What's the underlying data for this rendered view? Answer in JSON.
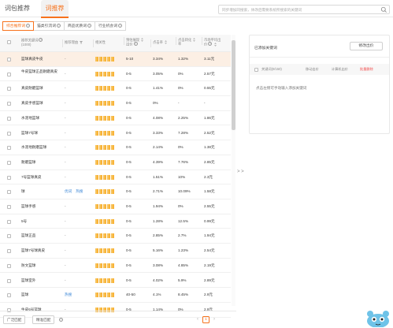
{
  "top_tabs": [
    {
      "label": "词包推荐",
      "active": false
    },
    {
      "label": "词推荐",
      "active": true
    }
  ],
  "search": {
    "placeholder": "同步增加同搜索，体改后需要系统所搜索的关键词"
  },
  "sub_tabs": [
    {
      "label": "综合推荐词",
      "active": true
    },
    {
      "label": "猫类引流词",
      "active": false
    },
    {
      "label": "商品优质词",
      "active": false
    },
    {
      "label": "行业机会词",
      "active": false
    }
  ],
  "table": {
    "headers": {
      "keyword": "推荐关键词",
      "keyword_sub": "(1000)",
      "reason": "推荐理由",
      "relevance": "相关性",
      "price": "预估展现",
      "price_sub": "出价",
      "ctr": "点击率",
      "cvr": "点击转化",
      "cvr_sub": "率",
      "avg": "市场平均出",
      "avg_sub": "价"
    },
    "rows": [
      {
        "keyword": "篮球真皮牛皮",
        "reason": "-",
        "reason_links": [],
        "relevance": 10,
        "price": "5-10",
        "ctr": "3.34%",
        "cvr": "1.32%",
        "avg": "3.11元"
      },
      {
        "keyword": "牛皮篮球正品耐磨真皮",
        "reason": "-",
        "reason_links": [],
        "relevance": 10,
        "price": "0-5",
        "ctr": "3.05%",
        "cvr": "0%",
        "avg": "2.57元"
      },
      {
        "keyword": "真皮耐磨篮球",
        "reason": "-",
        "reason_links": [],
        "relevance": 10,
        "price": "0-5",
        "ctr": "1.41%",
        "cvr": "0%",
        "avg": "0.55元"
      },
      {
        "keyword": "真皮手感篮球",
        "reason": "-",
        "reason_links": [],
        "relevance": 10,
        "price": "0-5",
        "ctr": "0%",
        "cvr": "-",
        "avg": "-"
      },
      {
        "keyword": "水泥地篮球",
        "reason": "-",
        "reason_links": [],
        "relevance": 10,
        "price": "0-5",
        "ctr": "4.08%",
        "cvr": "2.25%",
        "avg": "1.86元"
      },
      {
        "keyword": "篮球7号球",
        "reason": "-",
        "reason_links": [],
        "relevance": 10,
        "price": "0-5",
        "ctr": "3.33%",
        "cvr": "7.28%",
        "avg": "2.52元"
      },
      {
        "keyword": "水泥地耐磨篮球",
        "reason": "-",
        "reason_links": [],
        "relevance": 10,
        "price": "0-5",
        "ctr": "2.14%",
        "cvr": "0%",
        "avg": "1.38元"
      },
      {
        "keyword": "耐磨篮球",
        "reason": "-",
        "reason_links": [],
        "relevance": 10,
        "price": "0-5",
        "ctr": "4.39%",
        "cvr": "7.76%",
        "avg": "2.85元"
      },
      {
        "keyword": "7号篮球真皮",
        "reason": "-",
        "reason_links": [],
        "relevance": 10,
        "price": "0-5",
        "ctr": "1.51%",
        "cvr": "10%",
        "avg": "2.3元"
      },
      {
        "keyword": "球",
        "reason": "",
        "reason_links": [
          "优词",
          "热搜"
        ],
        "relevance": 10,
        "price": "0-5",
        "ctr": "2.71%",
        "cvr": "10.09%",
        "avg": "1.58元"
      },
      {
        "keyword": "篮球手感",
        "reason": "-",
        "reason_links": [],
        "relevance": 10,
        "price": "0-5",
        "ctr": "1.94%",
        "cvr": "0%",
        "avg": "2.55元"
      },
      {
        "keyword": "5号",
        "reason": "-",
        "reason_links": [],
        "relevance": 10,
        "price": "0-5",
        "ctr": "1.28%",
        "cvr": "12.5%",
        "avg": "0.99元"
      },
      {
        "keyword": "篮球正品",
        "reason": "-",
        "reason_links": [],
        "relevance": 10,
        "price": "0-5",
        "ctr": "2.85%",
        "cvr": "2.7%",
        "avg": "1.94元"
      },
      {
        "keyword": "篮球7号球真皮",
        "reason": "-",
        "reason_links": [],
        "relevance": 10,
        "price": "0-5",
        "ctr": "5.16%",
        "cvr": "1.23%",
        "avg": "2.54元"
      },
      {
        "keyword": "防文篮球",
        "reason": "-",
        "reason_links": [],
        "relevance": 10,
        "price": "0-5",
        "ctr": "3.08%",
        "cvr": "4.85%",
        "avg": "2.19元"
      },
      {
        "keyword": "篮球室外",
        "reason": "-",
        "reason_links": [],
        "relevance": 10,
        "price": "0-5",
        "ctr": "4.02%",
        "cvr": "5.9%",
        "avg": "2.89元"
      },
      {
        "keyword": "篮球",
        "reason": "",
        "reason_links": [
          "热搜"
        ],
        "relevance": 10,
        "price": "40-50",
        "ctr": "4.1%",
        "cvr": "8.45%",
        "avg": "2.9元"
      },
      {
        "keyword": "牛皮6号篮球",
        "reason": "-",
        "reason_links": [],
        "relevance": 10,
        "price": "0-5",
        "ctr": "1.14%",
        "cvr": "0%",
        "avg": "2.9元"
      }
    ]
  },
  "footer": {
    "btn_broad": "广泛匹配",
    "btn_exact": "精准匹配",
    "page": "1",
    "prev": "‹",
    "next": "›"
  },
  "transfer_arrows": "> >",
  "right_panel": {
    "title": "已添加关键词",
    "modify_button": "修改出价",
    "columns": {
      "keyword": "关键词(0/150)",
      "mobile": "移动出价",
      "pc": "计算机出价",
      "delete": "批量删除"
    },
    "empty_text": "点击左侧可手动输入添加关键词"
  },
  "colors": {
    "accent": "#f7721c",
    "link": "#3a86d6",
    "delete": "#f24d4d",
    "bar": "#f9b43a"
  }
}
